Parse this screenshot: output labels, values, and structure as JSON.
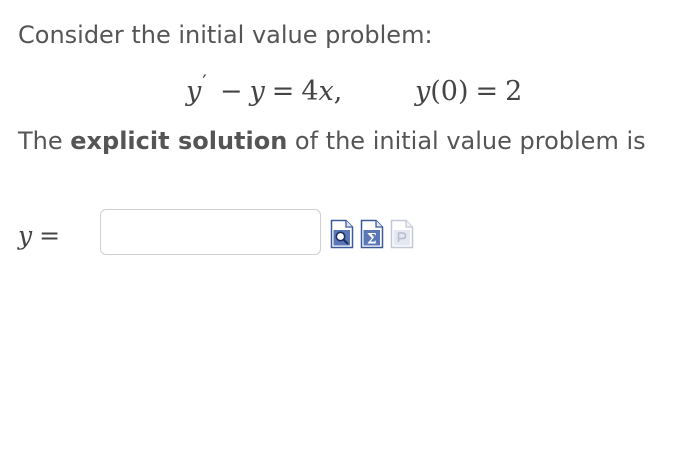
{
  "question": {
    "intro": "Consider the initial value problem:",
    "equation": {
      "lhs_symbol": "y",
      "prime": "′",
      "minus": "−",
      "y": "y",
      "equals": "=",
      "rhs_coeff": "4",
      "rhs_var": "x",
      "comma": ",",
      "ic_fn": "y",
      "ic_arg": "(0)",
      "ic_equals": "=",
      "ic_value": "2"
    },
    "solution_prefix": "The ",
    "solution_bold": "explicit solution",
    "solution_suffix": " of the initial value problem is"
  },
  "answer": {
    "label_var": "y",
    "label_equals": "=",
    "input_value": ""
  },
  "toolbar": {
    "icons": [
      "preview-icon",
      "sigma-icon",
      "help-icon"
    ],
    "sigma_glyph": "Σ",
    "preview_color": "#3c5a9a",
    "disabled_color": "#c4c8d6"
  }
}
